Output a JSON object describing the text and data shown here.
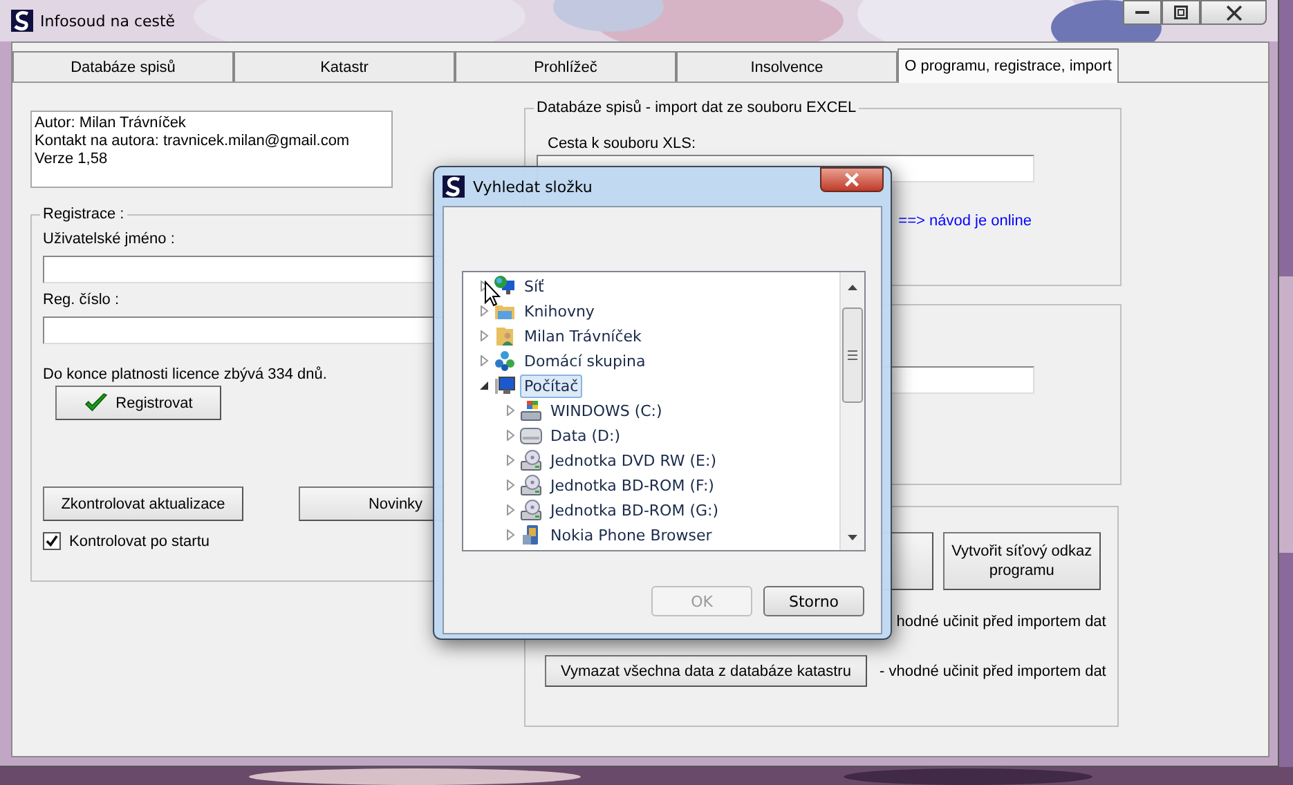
{
  "window": {
    "title": "Infosoud na cestě"
  },
  "tabs": [
    {
      "label": "Databáze spisů",
      "selected": false
    },
    {
      "label": "Katastr",
      "selected": false
    },
    {
      "label": "Prohlížeč",
      "selected": false
    },
    {
      "label": "Insolvence",
      "selected": false
    },
    {
      "label": "O programu, registrace, import",
      "selected": true
    }
  ],
  "about": [
    "Autor: Milan Trávníček",
    "Kontakt na autora: travnicek.milan@gmail.com",
    "Verze 1,58"
  ],
  "registration": {
    "title": "Registrace :",
    "username_label": "Uživatelské jméno :",
    "number_label": "Reg. číslo :",
    "license_text": "Do konce platnosti licence zbývá 334 dnů.",
    "register_button": "Registrovat",
    "update_button": "Zkontrolovat aktualizace",
    "news_button": "Novinky",
    "check_on_start": {
      "label": "Kontrolovat po startu",
      "checked": true
    }
  },
  "excel_import": {
    "title": "Databáze spisů - import dat ze souboru EXCEL",
    "path_label": "Cesta k souboru XLS:",
    "link": "==> návod je online"
  },
  "tools": {
    "network_link_button": "Vytvořit síťový odkaz programu",
    "note_1": "hodné učinit před importem dat",
    "delete_button": "Vymazat všechna data z databáze katastru",
    "note_2": "- vhodné učinit před importem dat"
  },
  "dialog": {
    "title": "Vyhledat složku",
    "tree": [
      {
        "label": "Síť",
        "kind": "network",
        "expanded": false,
        "selected": false
      },
      {
        "label": "Knihovny",
        "kind": "library",
        "expanded": false,
        "selected": false
      },
      {
        "label": "Milan Trávníček",
        "kind": "user",
        "expanded": false,
        "selected": false
      },
      {
        "label": "Domácí skupina",
        "kind": "homegroup",
        "expanded": false,
        "selected": false
      },
      {
        "label": "Počítač",
        "kind": "computer",
        "expanded": true,
        "selected": true,
        "children": [
          {
            "label": "WINDOWS (C:)",
            "kind": "system-drive",
            "expanded": false,
            "selected": false
          },
          {
            "label": "Data (D:)",
            "kind": "drive",
            "expanded": false,
            "selected": false
          },
          {
            "label": "Jednotka DVD RW (E:)",
            "kind": "optical",
            "expanded": false,
            "selected": false
          },
          {
            "label": "Jednotka BD-ROM (F:)",
            "kind": "optical",
            "expanded": false,
            "selected": false
          },
          {
            "label": "Jednotka BD-ROM (G:)",
            "kind": "optical",
            "expanded": false,
            "selected": false
          },
          {
            "label": "Nokia Phone Browser",
            "kind": "phone",
            "expanded": false,
            "selected": false
          }
        ]
      }
    ],
    "ok": {
      "label": "OK",
      "disabled": true
    },
    "cancel": {
      "label": "Storno"
    }
  }
}
